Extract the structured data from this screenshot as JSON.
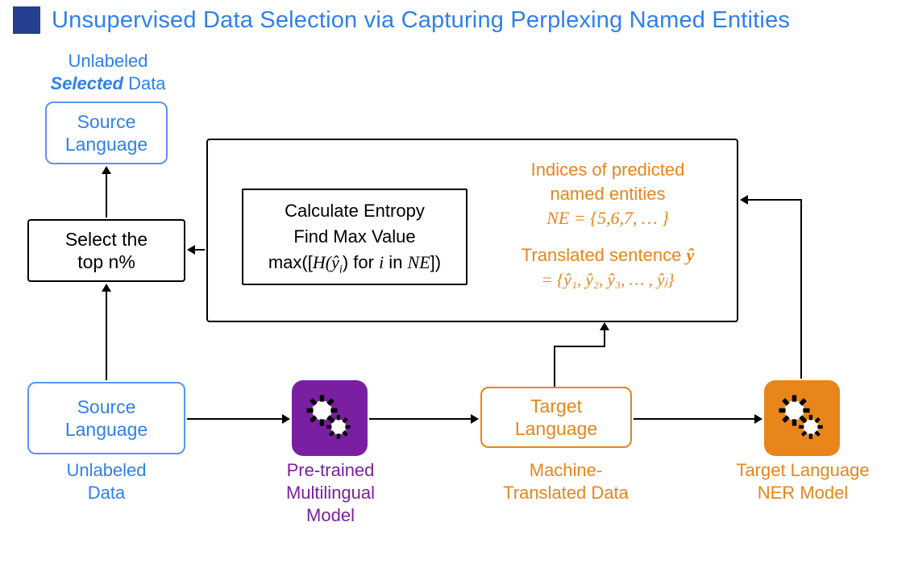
{
  "title": "Unsupervised Data Selection via Capturing Perplexing Named Entities",
  "selectedHeader": {
    "line1": "Unlabeled",
    "selected": "Selected",
    "line2tail": "  Data"
  },
  "boxes": {
    "sourceLanguage": "Source\nLanguage",
    "selectTopN": "Select the\ntop n%",
    "targetLanguage": "Target\nLanguage"
  },
  "calcBox": {
    "l1": "Calculate Entropy",
    "l2": "Find Max Value",
    "l3_prefix": "max([",
    "l3_H": "H",
    "l3_of": "(ŷ",
    "l3_i": "i",
    "l3_mid": ") for ",
    "l3_i2": "i",
    "l3_in": " in ",
    "l3_NE": "NE",
    "l3_close": "])"
  },
  "indices": {
    "l1": "Indices of predicted",
    "l2": "named entities",
    "l3": "NE = {5,6,7, … }"
  },
  "translated": {
    "l1_prefix": "Translated sentence ",
    "l1_yhat": "ŷ",
    "l2": "= {ŷ₁, ŷ₂, ŷ₃, … , ŷⱼ}"
  },
  "labels": {
    "unlabeled": "Unlabeled\nData",
    "pretrained": "Pre-trained\nMultilingual\nModel",
    "machine": "Machine-\nTranslated Data",
    "ner": "Target Language\nNER Model"
  },
  "icons": {
    "gears": "gears-icon"
  },
  "colors": {
    "blue": "#2f80ed",
    "navy": "#25408f",
    "orange": "#e8851b",
    "purple": "#7b1fa2"
  }
}
